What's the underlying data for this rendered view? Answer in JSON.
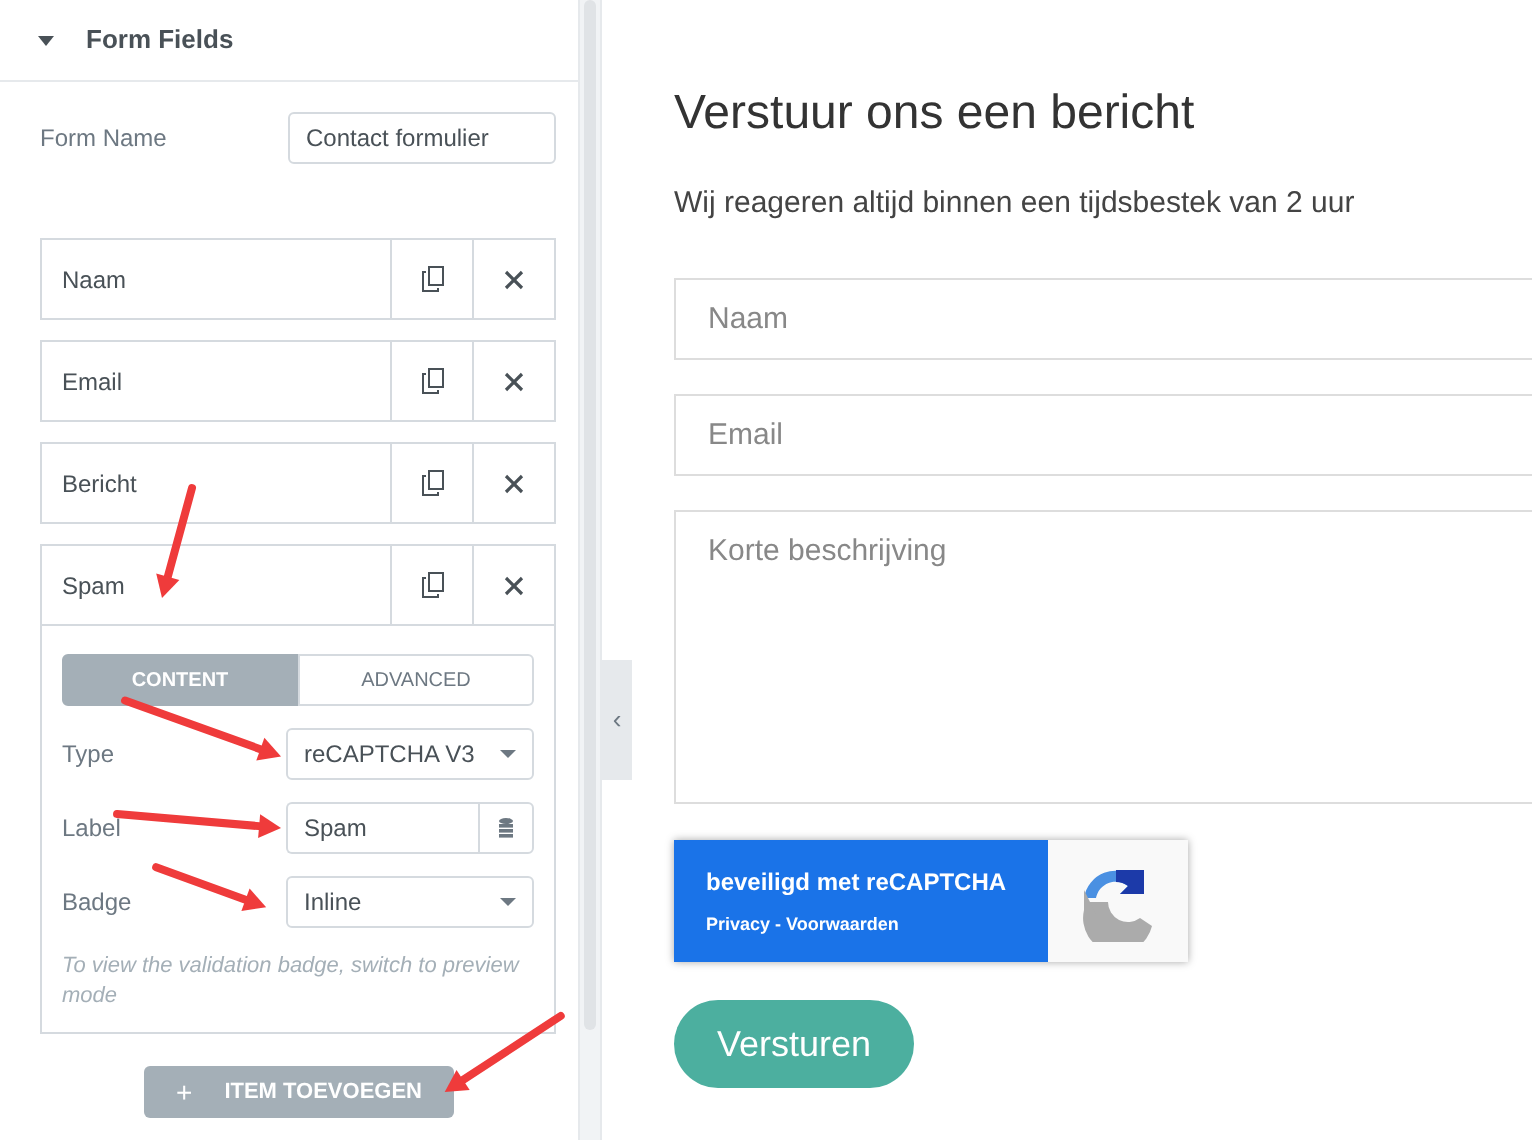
{
  "panel": {
    "section_title": "Form Fields",
    "section_expanded": true,
    "form_name": {
      "label": "Form Name",
      "value": "Contact formulier"
    },
    "fields": [
      {
        "label": "Naam",
        "expanded": false
      },
      {
        "label": "Email",
        "expanded": false
      },
      {
        "label": "Bericht",
        "expanded": false
      },
      {
        "label": "Spam",
        "expanded": true,
        "annotated": true,
        "tabs": [
          {
            "label": "CONTENT",
            "selected": true
          },
          {
            "label": "ADVANCED",
            "selected": false
          }
        ],
        "settings": [
          {
            "kind": "select",
            "label": "Type",
            "value": "reCAPTCHA V3",
            "annotated": true
          },
          {
            "kind": "dynamic",
            "label": "Label",
            "value": "Spam",
            "annotated": true
          },
          {
            "kind": "select",
            "label": "Badge",
            "value": "Inline",
            "annotated": true
          }
        ],
        "hint": "To view the validation badge, switch to preview mode"
      }
    ],
    "add_button": {
      "icon": "+",
      "label": "ITEM TOEVOEGEN",
      "annotated": true
    },
    "collapse_handle": "‹"
  },
  "form": {
    "title": "Verstuur ons een bericht",
    "subtitle": "Wij reageren altijd binnen een tijdsbestek van 2 uur",
    "inputs": [
      {
        "kind": "input",
        "placeholder": "Naam"
      },
      {
        "kind": "input",
        "placeholder": "Email"
      },
      {
        "kind": "textarea",
        "placeholder": "Korte beschrijving"
      }
    ],
    "recaptcha": {
      "title": "beveiligd met reCAPTCHA",
      "links": "Privacy - Voorwaarden"
    },
    "submit": "Versturen"
  }
}
